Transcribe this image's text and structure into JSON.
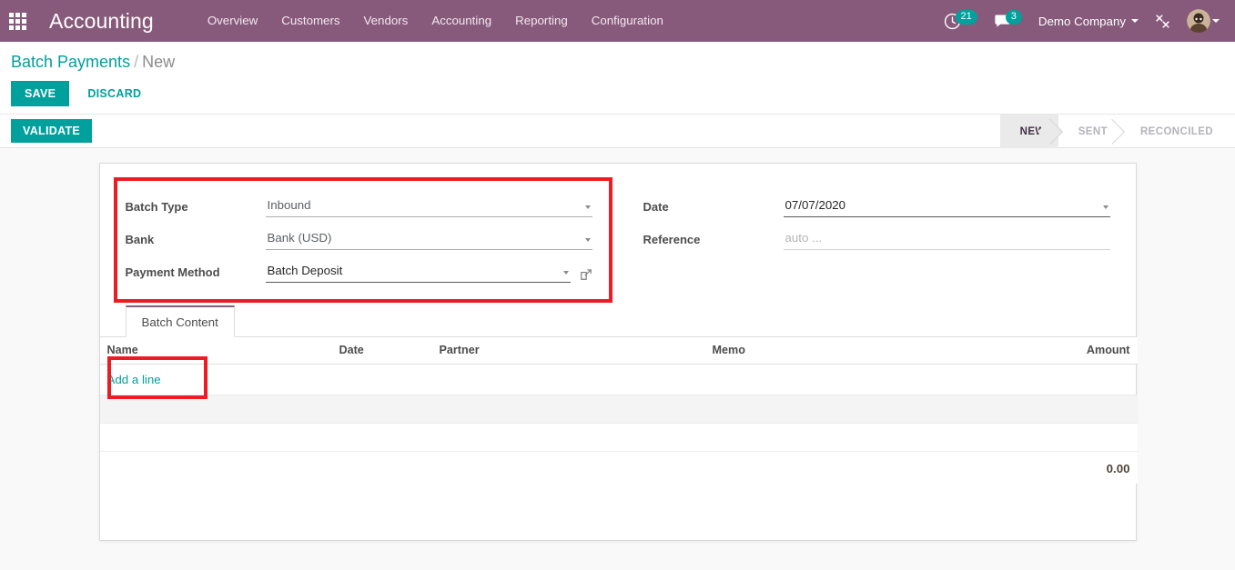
{
  "navbar": {
    "apps_icon": "apps-grid-icon",
    "brand": "Accounting",
    "menu": [
      {
        "label": "Overview"
      },
      {
        "label": "Customers"
      },
      {
        "label": "Vendors"
      },
      {
        "label": "Accounting"
      },
      {
        "label": "Reporting"
      },
      {
        "label": "Configuration"
      }
    ],
    "activities": {
      "icon": "clock-icon",
      "count": "21"
    },
    "messages": {
      "icon": "chat-bubble-icon",
      "count": "3"
    },
    "company": "Demo Company",
    "debug_icon": "wrench-screwdriver-icon",
    "avatar_icon": "user-avatar"
  },
  "control_panel": {
    "breadcrumb_root": "Batch Payments",
    "breadcrumb_sep": "/",
    "breadcrumb_current": "New",
    "save_label": "SAVE",
    "discard_label": "DISCARD"
  },
  "statusbar": {
    "validate_label": "VALIDATE",
    "stages": [
      {
        "label": "NEW",
        "active": true
      },
      {
        "label": "SENT",
        "active": false
      },
      {
        "label": "RECONCILED",
        "active": false
      }
    ]
  },
  "form": {
    "left": [
      {
        "label": "Batch Type",
        "value": "Inbound",
        "placeholder": "",
        "has_dropdown": true,
        "has_link": false
      },
      {
        "label": "Bank",
        "value": "Bank (USD)",
        "placeholder": "",
        "has_dropdown": true,
        "has_link": false
      },
      {
        "label": "Payment Method",
        "value": "Batch Deposit",
        "placeholder": "",
        "has_dropdown": true,
        "has_link": true
      }
    ],
    "right": [
      {
        "label": "Date",
        "value": "07/07/2020",
        "placeholder": "",
        "has_dropdown": true,
        "has_link": false
      },
      {
        "label": "Reference",
        "value": "",
        "placeholder": "auto ...",
        "has_dropdown": false,
        "has_link": false
      }
    ]
  },
  "notebook": {
    "tabs": [
      {
        "label": "Batch Content",
        "active": true
      }
    ],
    "table": {
      "columns": [
        "Name",
        "Date",
        "Partner",
        "Memo",
        "Amount"
      ],
      "rows": [],
      "add_line_label": "Add a line",
      "total": "0.00"
    }
  },
  "colors": {
    "brand_purple": "#875A7B",
    "accent_teal": "#00A09D",
    "highlight_red": "#ED1C24",
    "page_bg": "#f9f9f9"
  }
}
